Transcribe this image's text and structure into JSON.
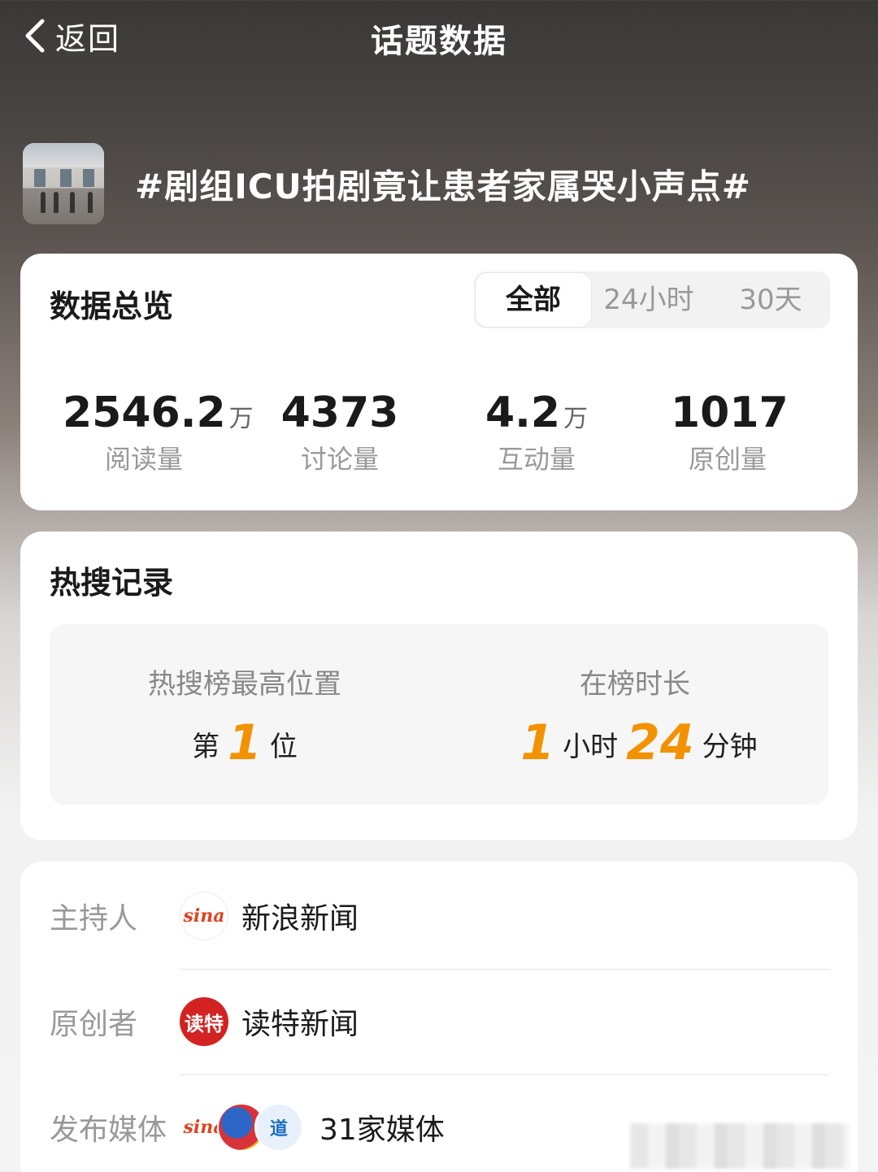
{
  "nav": {
    "back_label": "返回",
    "title": "话题数据"
  },
  "topic": {
    "title": "#剧组ICU拍剧竟让患者家属哭小声点#"
  },
  "overview": {
    "title": "数据总览",
    "tabs": [
      {
        "label": "全部",
        "active": true
      },
      {
        "label": "24小时",
        "active": false
      },
      {
        "label": "30天",
        "active": false
      }
    ],
    "stats": [
      {
        "value": "2546.2",
        "unit": "万",
        "label": "阅读量"
      },
      {
        "value": "4373",
        "unit": "",
        "label": "讨论量"
      },
      {
        "value": "4.2",
        "unit": "万",
        "label": "互动量"
      },
      {
        "value": "1017",
        "unit": "",
        "label": "原创量"
      }
    ]
  },
  "hot_search": {
    "title": "热搜记录",
    "peak": {
      "label": "热搜榜最高位置",
      "prefix": "第",
      "value": "1",
      "suffix": "位"
    },
    "duration": {
      "label": "在榜时长",
      "hours": "1",
      "hours_unit": "小时",
      "minutes": "24",
      "minutes_unit": "分钟"
    }
  },
  "info": {
    "host": {
      "label": "主持人",
      "logo_text": "sina",
      "name": "新浪新闻"
    },
    "creator": {
      "label": "原创者",
      "logo_text": "读特",
      "name": "读特新闻"
    },
    "media": {
      "label": "发布媒体",
      "logo_text": "sina",
      "logo3_text": "道",
      "name": "31家媒体"
    }
  },
  "colors": {
    "accent": "#f39200",
    "card": "#ffffff",
    "muted": "#999999"
  }
}
